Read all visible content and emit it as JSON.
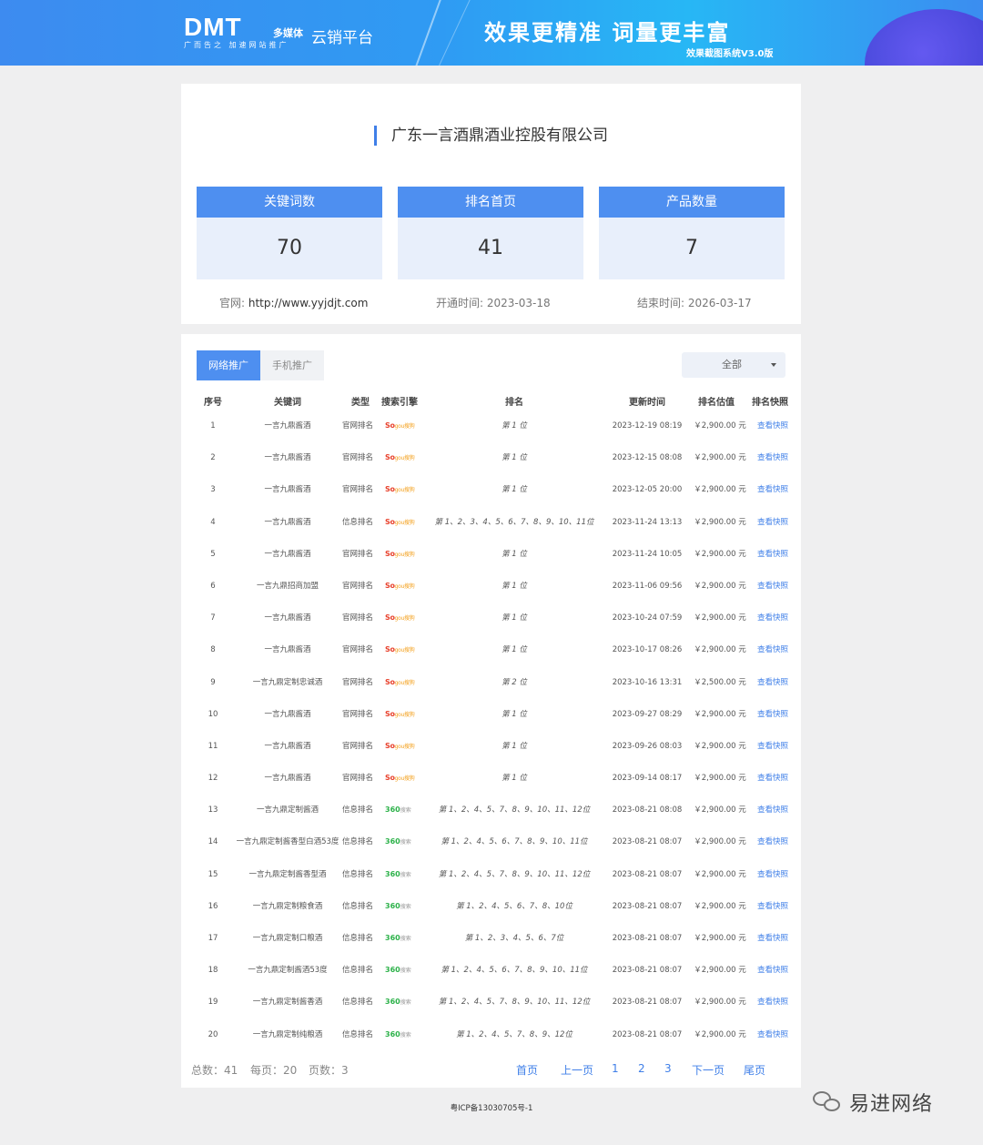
{
  "header": {
    "logo_main": "DMT",
    "logo_media": "多媒体",
    "logo_sub": "广而告之  加速网站推广",
    "platform": "云销平台",
    "slogan": "效果更精准  词量更丰富",
    "version": "效果截图系统V3.0版"
  },
  "company": {
    "name": "广东一言酒鼎酒业控股有限公司",
    "stats": [
      {
        "label": "关键词数",
        "value": "70"
      },
      {
        "label": "排名首页",
        "value": "41"
      },
      {
        "label": "产品数量",
        "value": "7"
      }
    ],
    "website_label": "官网:",
    "website": "http://www.yyjdjt.com",
    "open_label": "开通时间:",
    "open_date": "2023-03-18",
    "end_label": "结束时间:",
    "end_date": "2026-03-17"
  },
  "tabs": {
    "active": "网络推广",
    "inactive": "手机推广"
  },
  "filter": {
    "selected": "全部"
  },
  "table": {
    "headers": [
      "序号",
      "关键词",
      "类型",
      "搜索引擎",
      "排名",
      "更新时间",
      "排名估值",
      "排名快照"
    ],
    "rows": [
      {
        "idx": "1",
        "kw": "一言九鼎酱酒",
        "type": "官网排名",
        "engine": "sogou",
        "rank": "第 1 位",
        "time": "2023-12-19 08:19",
        "price": "￥2,900.00 元",
        "snap": "查看快照"
      },
      {
        "idx": "2",
        "kw": "一言九鼎酱酒",
        "type": "官网排名",
        "engine": "sogou",
        "rank": "第 1 位",
        "time": "2023-12-15 08:08",
        "price": "￥2,900.00 元",
        "snap": "查看快照"
      },
      {
        "idx": "3",
        "kw": "一言九鼎酱酒",
        "type": "官网排名",
        "engine": "sogou",
        "rank": "第 1 位",
        "time": "2023-12-05 20:00",
        "price": "￥2,900.00 元",
        "snap": "查看快照"
      },
      {
        "idx": "4",
        "kw": "一言九鼎酱酒",
        "type": "信息排名",
        "engine": "sogou",
        "rank": "第 1、2、3、4、5、6、7、8、9、10、11位",
        "time": "2023-11-24 13:13",
        "price": "￥2,900.00 元",
        "snap": "查看快照"
      },
      {
        "idx": "5",
        "kw": "一言九鼎酱酒",
        "type": "官网排名",
        "engine": "sogou",
        "rank": "第 1 位",
        "time": "2023-11-24 10:05",
        "price": "￥2,900.00 元",
        "snap": "查看快照"
      },
      {
        "idx": "6",
        "kw": "一言九鼎招商加盟",
        "type": "官网排名",
        "engine": "sogou",
        "rank": "第 1 位",
        "time": "2023-11-06 09:56",
        "price": "￥2,900.00 元",
        "snap": "查看快照"
      },
      {
        "idx": "7",
        "kw": "一言九鼎酱酒",
        "type": "官网排名",
        "engine": "sogou",
        "rank": "第 1 位",
        "time": "2023-10-24 07:59",
        "price": "￥2,900.00 元",
        "snap": "查看快照"
      },
      {
        "idx": "8",
        "kw": "一言九鼎酱酒",
        "type": "官网排名",
        "engine": "sogou",
        "rank": "第 1 位",
        "time": "2023-10-17 08:26",
        "price": "￥2,900.00 元",
        "snap": "查看快照"
      },
      {
        "idx": "9",
        "kw": "一言九鼎定制忠诚酒",
        "type": "官网排名",
        "engine": "sogou",
        "rank": "第 2 位",
        "time": "2023-10-16 13:31",
        "price": "￥2,500.00 元",
        "snap": "查看快照"
      },
      {
        "idx": "10",
        "kw": "一言九鼎酱酒",
        "type": "官网排名",
        "engine": "sogou",
        "rank": "第 1 位",
        "time": "2023-09-27 08:29",
        "price": "￥2,900.00 元",
        "snap": "查看快照"
      },
      {
        "idx": "11",
        "kw": "一言九鼎酱酒",
        "type": "官网排名",
        "engine": "sogou",
        "rank": "第 1 位",
        "time": "2023-09-26 08:03",
        "price": "￥2,900.00 元",
        "snap": "查看快照"
      },
      {
        "idx": "12",
        "kw": "一言九鼎酱酒",
        "type": "官网排名",
        "engine": "sogou",
        "rank": "第 1 位",
        "time": "2023-09-14 08:17",
        "price": "￥2,900.00 元",
        "snap": "查看快照"
      },
      {
        "idx": "13",
        "kw": "一言九鼎定制酱酒",
        "type": "信息排名",
        "engine": "360",
        "rank": "第 1、2、4、5、7、8、9、10、11、12位",
        "time": "2023-08-21 08:08",
        "price": "￥2,900.00 元",
        "snap": "查看快照"
      },
      {
        "idx": "14",
        "kw": "一言九鼎定制酱香型白酒53度",
        "type": "信息排名",
        "engine": "360",
        "rank": "第 1、2、4、5、6、7、8、9、10、11位",
        "time": "2023-08-21 08:07",
        "price": "￥2,900.00 元",
        "snap": "查看快照"
      },
      {
        "idx": "15",
        "kw": "一言九鼎定制酱香型酒",
        "type": "信息排名",
        "engine": "360",
        "rank": "第 1、2、4、5、7、8、9、10、11、12位",
        "time": "2023-08-21 08:07",
        "price": "￥2,900.00 元",
        "snap": "查看快照"
      },
      {
        "idx": "16",
        "kw": "一言九鼎定制粮食酒",
        "type": "信息排名",
        "engine": "360",
        "rank": "第 1、2、4、5、6、7、8、10位",
        "time": "2023-08-21 08:07",
        "price": "￥2,900.00 元",
        "snap": "查看快照"
      },
      {
        "idx": "17",
        "kw": "一言九鼎定制口粮酒",
        "type": "信息排名",
        "engine": "360",
        "rank": "第 1、2、3、4、5、6、7位",
        "time": "2023-08-21 08:07",
        "price": "￥2,900.00 元",
        "snap": "查看快照"
      },
      {
        "idx": "18",
        "kw": "一言九鼎定制酱酒53度",
        "type": "信息排名",
        "engine": "360",
        "rank": "第 1、2、4、5、6、7、8、9、10、11位",
        "time": "2023-08-21 08:07",
        "price": "￥2,900.00 元",
        "snap": "查看快照"
      },
      {
        "idx": "19",
        "kw": "一言九鼎定制酱香酒",
        "type": "信息排名",
        "engine": "360",
        "rank": "第 1、2、4、5、7、8、9、10、11、12位",
        "time": "2023-08-21 08:07",
        "price": "￥2,900.00 元",
        "snap": "查看快照"
      },
      {
        "idx": "20",
        "kw": "一言九鼎定制纯粮酒",
        "type": "信息排名",
        "engine": "360",
        "rank": "第 1、2、4、5、7、8、9、12位",
        "time": "2023-08-21 08:07",
        "price": "￥2,900.00 元",
        "snap": "查看快照"
      }
    ]
  },
  "engines": {
    "sogou": {
      "main": "So",
      "tail": "gou搜狗"
    },
    "360": {
      "main": "360",
      "tail": "搜索"
    }
  },
  "pagination": {
    "total": "总数：41",
    "per_page": "每页：20",
    "pages": "页数：3",
    "first": "首页",
    "prev": "上一页",
    "page_numbers": [
      "1",
      "2",
      "3"
    ],
    "next": "下一页",
    "last": "尾页"
  },
  "footer": {
    "icp": "粤ICP备13030705号-1"
  },
  "watermark": {
    "text": "易进网络",
    "icon": "wechat-icon"
  }
}
